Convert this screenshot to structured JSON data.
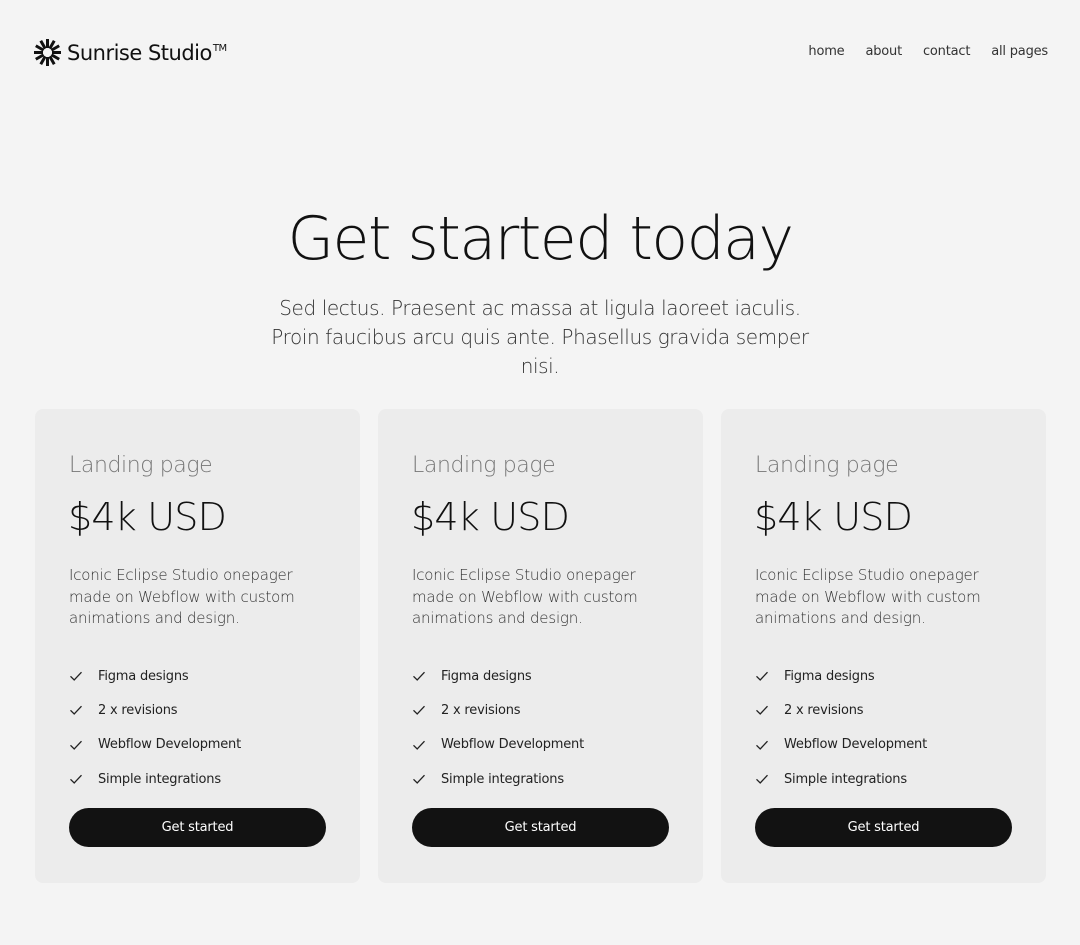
{
  "brand": {
    "name": "Sunrise Studio",
    "tm": "TM",
    "icon": "sunburst-logo-icon"
  },
  "nav": {
    "items": [
      "home",
      "about",
      "contact",
      "all pages"
    ]
  },
  "hero": {
    "title": "Get started today",
    "subtitle": "Sed lectus. Praesent ac massa at ligula laoreet iaculis. Proin faucibus arcu quis ante. Phasellus gravida semper nisi."
  },
  "cards": [
    {
      "title": "Landing page",
      "price": "$4k USD",
      "description": "Iconic Eclipse Studio onepager made on Webflow with custom animations and design.",
      "features": [
        "Figma designs",
        "2 x revisions",
        "Webflow Development",
        "Simple integrations"
      ],
      "cta": "Get started"
    },
    {
      "title": "Landing page",
      "price": "$4k USD",
      "description": "Iconic Eclipse Studio onepager made on Webflow with custom animations and design.",
      "features": [
        "Figma designs",
        "2 x revisions",
        "Webflow Development",
        "Simple integrations"
      ],
      "cta": "Get started"
    },
    {
      "title": "Landing page",
      "price": "$4k USD",
      "description": "Iconic Eclipse Studio onepager made on Webflow with custom animations and design.",
      "features": [
        "Figma designs",
        "2 x revisions",
        "Webflow Development",
        "Simple integrations"
      ],
      "cta": "Get started"
    }
  ],
  "icons": {
    "feature_icon": "check-icon"
  },
  "colors": {
    "background": "#f4f4f4",
    "card": "#ececec",
    "button": "#121212",
    "button_text": "#ffffff",
    "text": "#111111",
    "muted": "#777777"
  }
}
